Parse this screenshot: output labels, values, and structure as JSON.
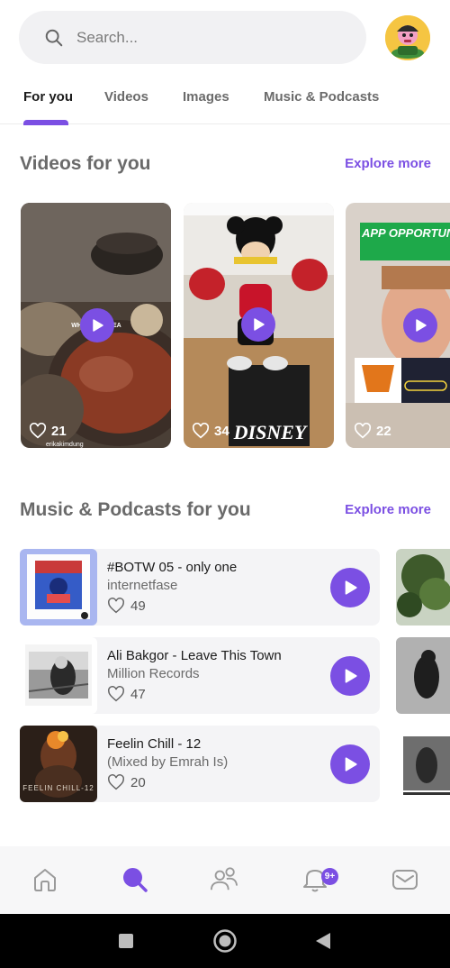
{
  "search": {
    "placeholder": "Search..."
  },
  "tabs": [
    {
      "label": "For you",
      "active": true
    },
    {
      "label": "Videos",
      "active": false
    },
    {
      "label": "Images",
      "active": false
    },
    {
      "label": "Music & Podcasts",
      "active": false
    }
  ],
  "videos_section": {
    "title": "Videos for you",
    "explore_label": "Explore more",
    "cards": [
      {
        "likes": "21",
        "thumb_text": "WHAT ... KOREA",
        "username": "erikakimdung"
      },
      {
        "likes": "34",
        "thumb_text": "DISNEY"
      },
      {
        "likes": "22",
        "thumb_text": "APP OPPORTUNI"
      }
    ]
  },
  "music_section": {
    "title": "Music & Podcasts for you",
    "explore_label": "Explore more",
    "items": [
      {
        "title": "#BOTW 05 - only one",
        "artist": "internetfase",
        "likes": "49"
      },
      {
        "title": "Ali Bakgor - Leave This Town",
        "artist": "Million Records",
        "likes": "47"
      },
      {
        "title": "Feelin Chill - 12",
        "artist": "(Mixed by Emrah Is)",
        "likes": "20"
      }
    ]
  },
  "bottom_nav": {
    "items": [
      "home-icon",
      "search-icon",
      "people-icon",
      "notification-icon",
      "mail-icon"
    ],
    "active": "search-icon",
    "notification_badge": "9+"
  },
  "colors": {
    "accent": "#7b4fe3",
    "search_bg": "#f1f1f3",
    "card_bg": "#f4f4f6"
  }
}
